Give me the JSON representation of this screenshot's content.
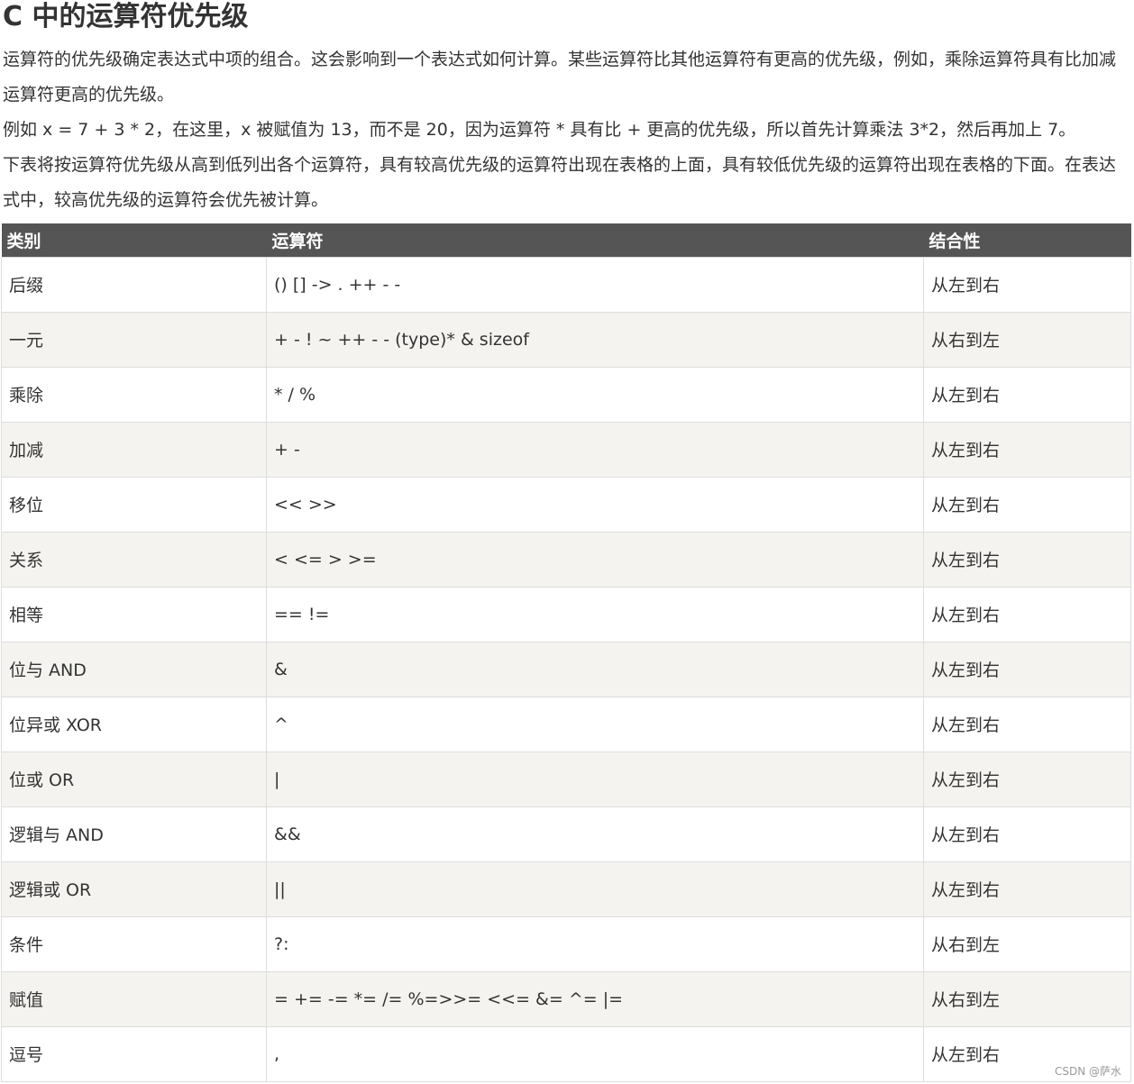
{
  "title": "C 中的运算符优先级",
  "intro": {
    "p1": "运算符的优先级确定表达式中项的组合。这会影响到一个表达式如何计算。某些运算符比其他运算符有更高的优先级，例如，乘除运算符具有比加减运算符更高的优先级。",
    "p2": "例如 x = 7 + 3 * 2，在这里，x 被赋值为 13，而不是 20，因为运算符 * 具有比 + 更高的优先级，所以首先计算乘法 3*2，然后再加上 7。",
    "p3": "下表将按运算符优先级从高到低列出各个运算符，具有较高优先级的运算符出现在表格的上面，具有较低优先级的运算符出现在表格的下面。在表达式中，较高优先级的运算符会优先被计算。"
  },
  "table": {
    "headers": [
      "类别",
      "运算符",
      "结合性"
    ],
    "rows": [
      {
        "category": "后缀",
        "operators": "() [] -> . ++ - -",
        "assoc": "从左到右"
      },
      {
        "category": "一元",
        "operators": "+ - ! ~ ++ - - (type)* & sizeof",
        "assoc": "从右到左"
      },
      {
        "category": "乘除",
        "operators": "* / %",
        "assoc": "从左到右"
      },
      {
        "category": "加减",
        "operators": "+ -",
        "assoc": "从左到右"
      },
      {
        "category": "移位",
        "operators": "<< >>",
        "assoc": "从左到右"
      },
      {
        "category": "关系",
        "operators": "< <= > >=",
        "assoc": "从左到右"
      },
      {
        "category": "相等",
        "operators": "== !=",
        "assoc": "从左到右"
      },
      {
        "category": "位与 AND",
        "operators": "&",
        "assoc": "从左到右"
      },
      {
        "category": "位异或 XOR",
        "operators": "^",
        "assoc": "从左到右"
      },
      {
        "category": "位或 OR",
        "operators": "|",
        "assoc": "从左到右"
      },
      {
        "category": "逻辑与 AND",
        "operators": "&&",
        "assoc": "从左到右"
      },
      {
        "category": "逻辑或 OR",
        "operators": "||",
        "assoc": "从左到右"
      },
      {
        "category": "条件",
        "operators": "?:",
        "assoc": "从右到左"
      },
      {
        "category": "赋值",
        "operators": "= += -= *= /= %=>>= <<= &= ^= |=",
        "assoc": "从右到左"
      },
      {
        "category": "逗号",
        "operators": ",",
        "assoc": "从左到右"
      }
    ]
  },
  "watermark": "CSDN @萨水"
}
